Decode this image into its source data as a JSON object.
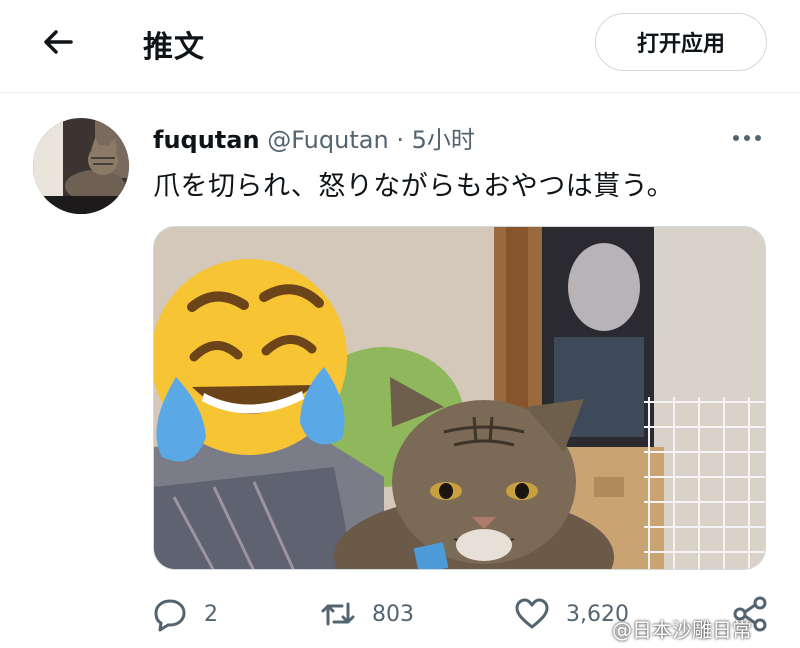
{
  "header": {
    "title": "推文",
    "open_app_label": "打开应用"
  },
  "tweet": {
    "display_name": "fuqutan",
    "handle": "@Fuqutan",
    "separator": "·",
    "time": "5小时",
    "text": "爪を切られ、怒りながらもおやつは貰う。"
  },
  "actions": {
    "replies": "2",
    "retweets": "803",
    "likes": "3,620"
  },
  "watermark": "@日本沙雕日常",
  "colors": {
    "muted": "#536471",
    "border": "#cfd9de",
    "text": "#0f1419"
  },
  "icons": [
    "back-arrow-icon",
    "more-icon",
    "reply-icon",
    "retweet-icon",
    "like-icon",
    "share-icon"
  ]
}
